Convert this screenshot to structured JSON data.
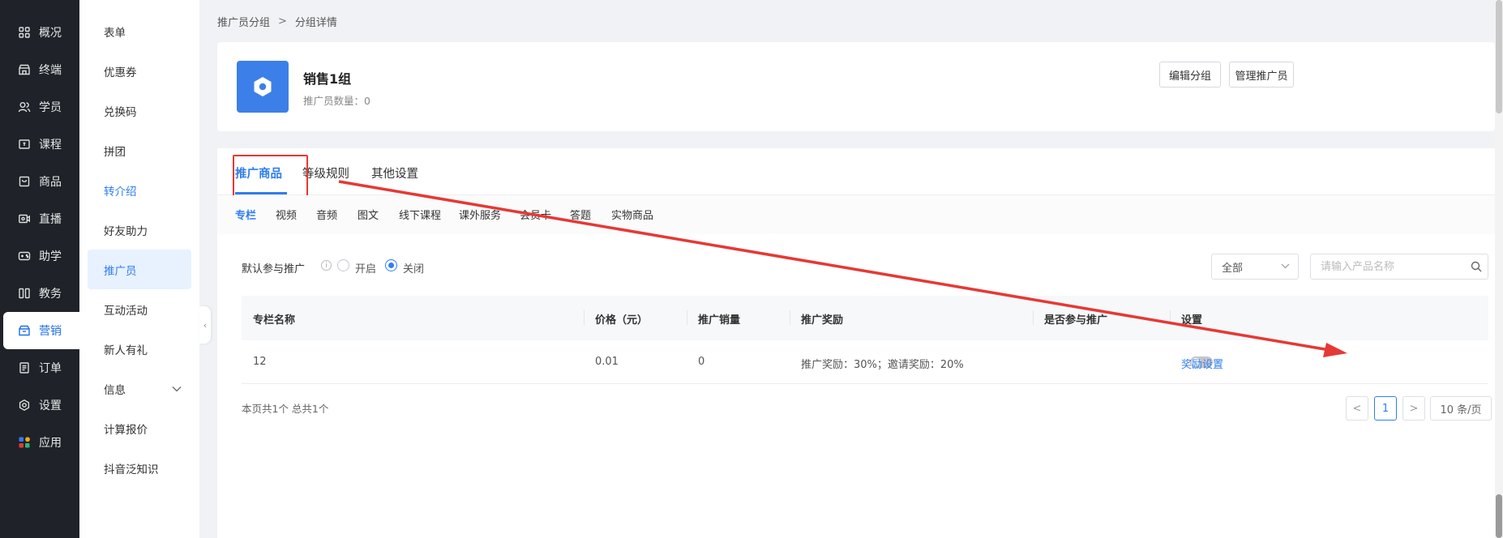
{
  "nav": {
    "items": [
      {
        "label": "概况",
        "icon": "grid-icon"
      },
      {
        "label": "终端",
        "icon": "store-icon"
      },
      {
        "label": "学员",
        "icon": "users-icon"
      },
      {
        "label": "课程",
        "icon": "course-icon"
      },
      {
        "label": "商品",
        "icon": "goods-icon"
      },
      {
        "label": "直播",
        "icon": "live-icon"
      },
      {
        "label": "助学",
        "icon": "gamepad-icon"
      },
      {
        "label": "教务",
        "icon": "book-icon"
      },
      {
        "label": "营销",
        "icon": "marketing-icon"
      },
      {
        "label": "订单",
        "icon": "order-icon"
      },
      {
        "label": "设置",
        "icon": "gear-icon"
      },
      {
        "label": "应用",
        "icon": "apps-icon"
      }
    ]
  },
  "subnav": {
    "items": [
      {
        "label": "表单"
      },
      {
        "label": "优惠券"
      },
      {
        "label": "兑换码"
      },
      {
        "label": "拼团"
      },
      {
        "label": "转介绍"
      },
      {
        "label": "好友助力"
      },
      {
        "label": "推广员"
      },
      {
        "label": "互动活动"
      },
      {
        "label": "新人有礼"
      },
      {
        "label": "信息"
      },
      {
        "label": "计算报价"
      },
      {
        "label": "抖音泛知识"
      }
    ]
  },
  "breadcrumb": {
    "parent": "推广员分组",
    "sep": ">",
    "current": "分组详情"
  },
  "group": {
    "name": "销售1组",
    "count_text": "推广员数量：0"
  },
  "actions": {
    "edit": "编辑分组",
    "manage": "管理推广员"
  },
  "tabs": [
    "推广商品",
    "等级规则",
    "其他设置"
  ],
  "subtabs": [
    "专栏",
    "视频",
    "音频",
    "图文",
    "线下课程",
    "课外服务",
    "会员卡",
    "答题",
    "实物商品"
  ],
  "filter": {
    "label": "默认参与推广",
    "open": "开启",
    "close": "关闭",
    "select_value": "全部",
    "search_placeholder": "请输入产品名称"
  },
  "table": {
    "headers": [
      "专栏名称",
      "价格（元）",
      "推广销量",
      "推广奖励",
      "是否参与推广",
      "设置"
    ],
    "rows": [
      {
        "name": "12",
        "price": "0.01",
        "sales": "0",
        "reward": "推广奖励：30%；邀请奖励：20%",
        "participate": false,
        "action": "奖励设置"
      }
    ]
  },
  "pager": {
    "summary": "本页共1个 总共1个",
    "prev": "<",
    "page": "1",
    "next": ">",
    "size": "10 条/页"
  },
  "colors": {
    "accent": "#2f7ef0",
    "annotation": "#e53935",
    "nav_bg": "#1f2229"
  }
}
